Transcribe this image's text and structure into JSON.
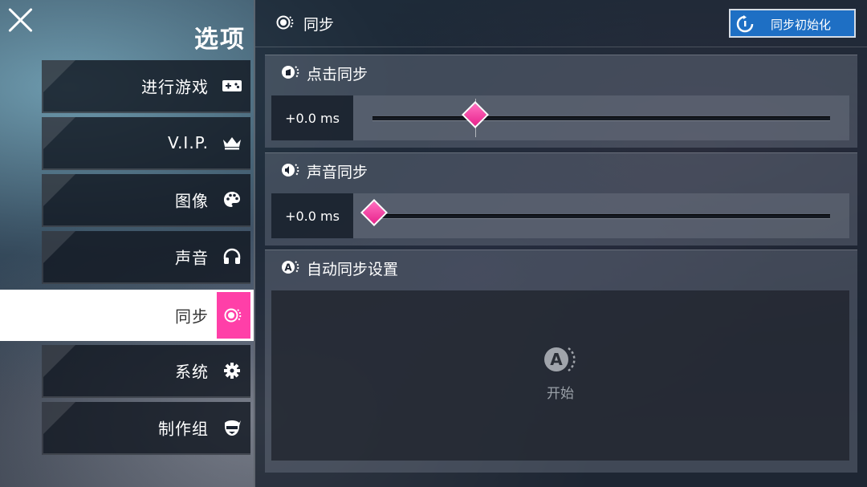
{
  "sidebar": {
    "title": "选项",
    "items": [
      {
        "label": "进行游戏",
        "icon": "gamepad-icon"
      },
      {
        "label": "V.I.P.",
        "icon": "crown-icon"
      },
      {
        "label": "图像",
        "icon": "palette-icon"
      },
      {
        "label": "声音",
        "icon": "headphones-icon"
      },
      {
        "label": "同步",
        "icon": "sync-icon",
        "active": true
      },
      {
        "label": "系统",
        "icon": "gear-icon"
      },
      {
        "label": "制作组",
        "icon": "staff-mask-icon"
      }
    ]
  },
  "header": {
    "title": "同步",
    "reset_button": "同步初始化"
  },
  "sections": {
    "tap_sync": {
      "title": "点击同步",
      "value": "+0.0 ms"
    },
    "audio_sync": {
      "title": "声音同步",
      "value": "+0.0 ms"
    },
    "auto_sync": {
      "title": "自动同步设置",
      "start_label": "开始",
      "start_icon_letter": "A"
    }
  },
  "colors": {
    "accent": "#ff3fa8",
    "reset_button": "#1e6fc4"
  }
}
